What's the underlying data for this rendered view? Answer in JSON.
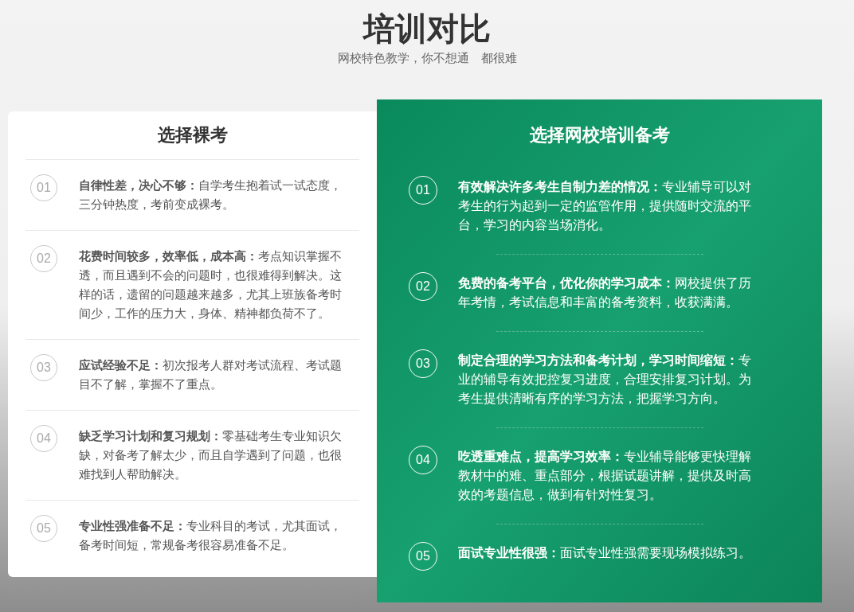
{
  "header": {
    "title": "培训对比",
    "subtitle": "网校特色教学，你不想通　都很难"
  },
  "left_panel": {
    "title": "选择裸考",
    "items": [
      {
        "number": "01",
        "text": "**自律性差，决心不够：**自学考生抱着试一试态度，三分钟热度，考前变成裸考。"
      },
      {
        "number": "02",
        "text": "**花费时间较多，效率低，成本高：**考点知识掌握不透，而且遇到不会的问题时，也很难得到解决。这样的话，遗留的问题越来越多，尤其上班族备考时间少，工作的压力大，身体、精神都负荷不了。"
      },
      {
        "number": "03",
        "text": "**应试经验不足：**初次报考人群对考试流程、考试题目不了解，掌握不了重点。"
      },
      {
        "number": "04",
        "text": "**缺乏学习计划和复习规划：**零基础考生专业知识欠缺，对备考了解太少，而且自学遇到了问题，也很难找到人帮助解决。"
      },
      {
        "number": "05",
        "text": "**专业性强准备不足：**专业科目的考试，尤其面试，备考时间短，常规备考很容易准备不足。"
      }
    ]
  },
  "right_panel": {
    "title": "选择网校培训备考",
    "items": [
      {
        "number": "01",
        "text": "**有效解决许多考生自制力差的情况：**专业辅导可以对考生的行为起到一定的监管作用，提供随时交流的平台，学习的内容当场消化。"
      },
      {
        "number": "02",
        "text": "**免费的备考平台，优化你的学习成本：**网校提供了历年考情，考试信息和丰富的备考资料，收获满满。"
      },
      {
        "number": "03",
        "text": "**制定合理的学习方法和备考计划，学习时间缩短：**专业的辅导有效把控复习进度，合理安排复习计划。为考生提供清晰有序的学习方法，把握学习方向。"
      },
      {
        "number": "04",
        "text": "**吃透重难点，提高学习效率：**专业辅导能够更快理解教材中的难、重点部分，根据试题讲解，提供及时高效的考题信息，做到有针对性复习。"
      },
      {
        "number": "05",
        "text": "**面试专业性很强：**面试专业性强需要现场模拟练习。"
      }
    ]
  }
}
